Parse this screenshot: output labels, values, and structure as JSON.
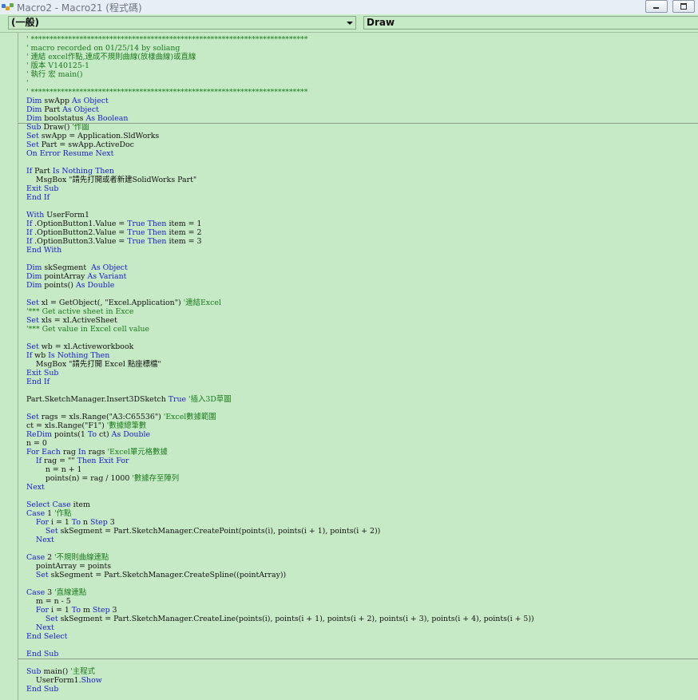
{
  "window": {
    "title": "Macro2 - Macro21 (程式碼)"
  },
  "object_combo": {
    "value": "(一般)"
  },
  "procedure_combo": {
    "value": "Draw"
  },
  "code_lines": [
    "' **************************************************************************",
    "' macro recorded on 01/25/14 by soliang",
    "' 連結 excel作點,連成不規則曲線(放樣曲線)或直線",
    "' 版本 V140125-1",
    "' 執行 宏 main()",
    "'",
    "' **************************************************************************",
    "Dim swApp As Object",
    "Dim Part As Object",
    "Dim boolstatus As Boolean",
    "Sub Draw() '作圖",
    "Set swApp = Application.SldWorks",
    "Set Part = swApp.ActiveDoc",
    "On Error Resume Next",
    "",
    "If Part Is Nothing Then",
    "    MsgBox \"請先打開或者新建SolidWorks Part\"",
    "Exit Sub",
    "End If",
    "",
    "With UserForm1",
    "If .OptionButton1.Value = True Then item = 1",
    "If .OptionButton2.Value = True Then item = 2",
    "If .OptionButton3.Value = True Then item = 3",
    "End With",
    "",
    "Dim skSegment  As Object",
    "Dim pointArray As Variant",
    "Dim points() As Double",
    "",
    "Set xl = GetObject(, \"Excel.Application\") '連結Excel",
    "'*** Get active sheet in Exce",
    "Set xls = xl.ActiveSheet",
    "'*** Get value in Excel cell value",
    "",
    "Set wb = xl.Activeworkbook",
    "If wb Is Nothing Then",
    "    MsgBox \"請先打開 Excel 點座標檔\"",
    "Exit Sub",
    "End If",
    "",
    "Part.SketchManager.Insert3DSketch True '插入3D草圖",
    "",
    "Set rags = xls.Range(\"A3:C65536\") 'Excel數據範圍",
    "ct = xls.Range(\"F1\") '數據總筆數",
    "ReDim points(1 To ct) As Double",
    "n = 0",
    "For Each rag In rags 'Excel單元格數據",
    "    If rag = \"\" Then Exit For",
    "        n = n + 1",
    "        points(n) = rag / 1000 '數據存至陣列",
    "Next",
    "",
    "Select Case item",
    "Case 1 '作點",
    "    For i = 1 To n Step 3",
    "        Set skSegment = Part.SketchManager.CreatePoint(points(i), points(i + 1), points(i + 2))",
    "    Next",
    "",
    "Case 2 '不規則曲線連點",
    "    pointArray = points",
    "    Set skSegment = Part.SketchManager.CreateSpline((pointArray))",
    "",
    "Case 3 '直線連點",
    "    m = n - 5",
    "    For i = 1 To m Step 3",
    "        Set skSegment = Part.SketchManager.CreateLine(points(i), points(i + 1), points(i + 2), points(i + 3), points(i + 4), points(i + 5))",
    "    Next",
    "End Select",
    "",
    "End Sub",
    "",
    "Sub main() '主程式",
    "    UserForm1.Show",
    "End Sub"
  ],
  "colors": {
    "background": "#c6e9c6",
    "comment": "#1a7a1a",
    "keyword": "#1a1acc"
  }
}
